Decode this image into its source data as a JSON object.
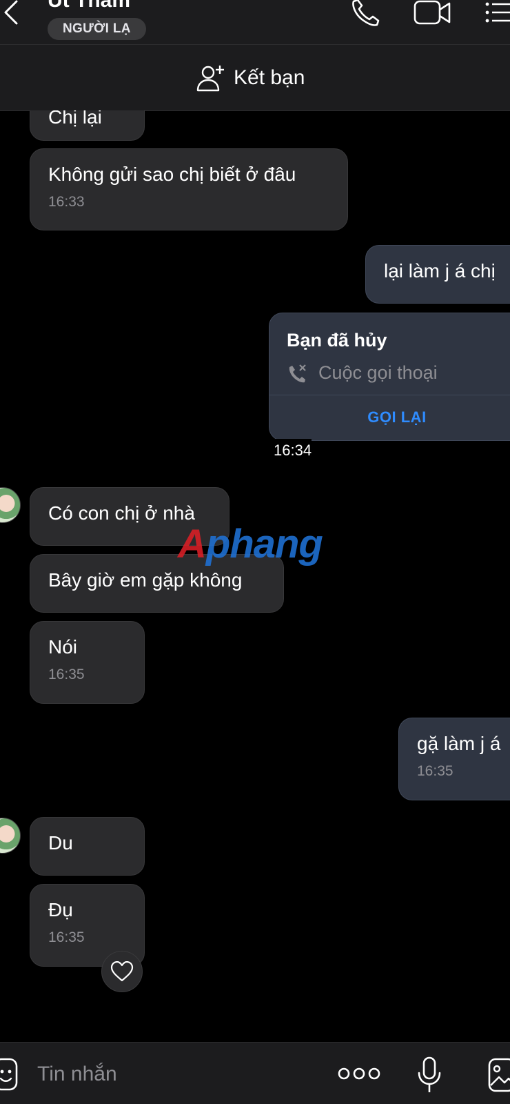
{
  "header": {
    "contact_name": "Út Thắm",
    "badge": "NGƯỜI LẠ"
  },
  "add_friend": {
    "label": "Kết bạn"
  },
  "messages": [
    {
      "side": "in",
      "text": "Chị lại"
    },
    {
      "side": "in",
      "text": "Không gửi sao chị biết ở đâu",
      "time": "16:33"
    },
    {
      "side": "out",
      "text": "lại làm j á chị"
    },
    {
      "side": "in",
      "text": "Có con chị ở nhà"
    },
    {
      "side": "in",
      "text": "Bây giờ em gặp không"
    },
    {
      "side": "in",
      "text": "Nói",
      "time": "16:35"
    },
    {
      "side": "out",
      "text": "gặ làm j á",
      "time": "16:35"
    },
    {
      "side": "in",
      "text": "Du"
    },
    {
      "side": "in",
      "text": "Đụ",
      "time": "16:35"
    }
  ],
  "call_card": {
    "title": "Bạn đã hủy",
    "subtitle": "Cuộc gọi thoại",
    "action": "GỌI LẠI",
    "time": "16:34"
  },
  "watermark": {
    "part1": "A",
    "part2": "phang"
  },
  "input": {
    "placeholder": "Tin nhắn"
  },
  "icons": {
    "back": "chevron-left-icon",
    "call": "phone-icon",
    "video": "video-camera-icon",
    "menu": "list-menu-icon",
    "add_friend": "add-user-icon",
    "missed_call": "phone-cancel-icon",
    "reaction": "heart-icon",
    "sticker": "sticker-icon",
    "more": "more-dots-icon",
    "mic": "microphone-icon",
    "image": "image-icon"
  },
  "colors": {
    "accent_link": "#2f8cff",
    "incoming_bubble": "#2b2b2d",
    "outgoing_bubble": "#2f3542",
    "background": "#000000"
  }
}
